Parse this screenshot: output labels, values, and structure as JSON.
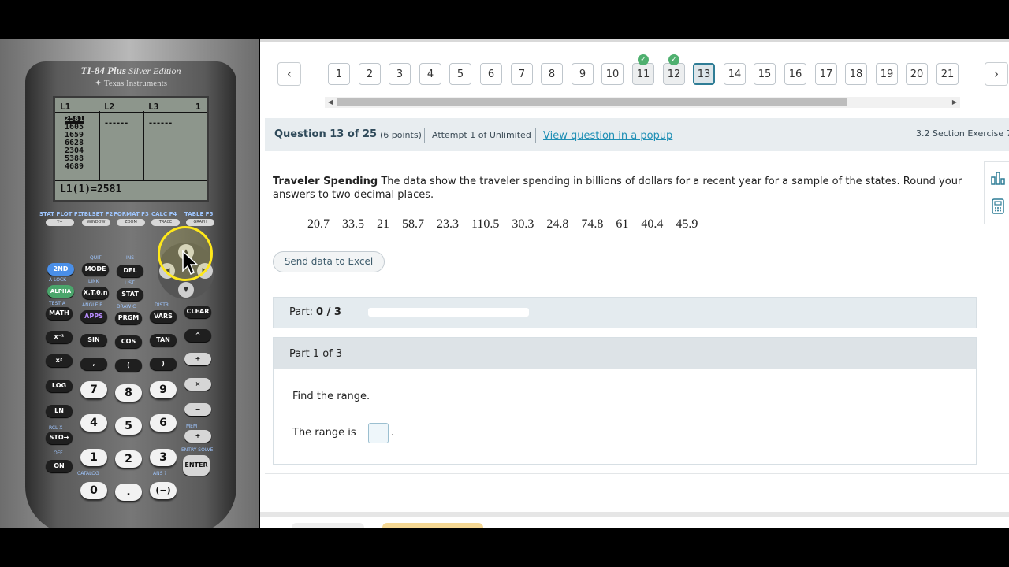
{
  "calculator": {
    "brand": "TI-84 Plus",
    "edition": "Silver Edition",
    "manufacturer": "Texas Instruments",
    "screen": {
      "col_headers": [
        "L1",
        "L2",
        "L3"
      ],
      "col_index": "1",
      "list_values": [
        "2581",
        "1605",
        "1659",
        "6628",
        "2304",
        "5388",
        "4689"
      ],
      "dashes": "------",
      "status_line": "L1(1)=2581"
    },
    "fn_labels": [
      "STAT PLOT F1",
      "TBLSET F2",
      "FORMAT F3",
      "CALC F4",
      "TABLE F5"
    ],
    "fn_keys": [
      "Y=",
      "WINDOW",
      "ZOOM",
      "TRACE",
      "GRAPH"
    ],
    "keys": {
      "second": "2ND",
      "mode": "MODE",
      "del": "DEL",
      "alpha": "ALPHA",
      "xt": "X,T,θ,n",
      "stat": "STAT",
      "math": "MATH",
      "apps": "APPS",
      "prgm": "PRGM",
      "vars": "VARS",
      "clear": "CLEAR",
      "inv": "x⁻¹",
      "sin": "SIN",
      "cos": "COS",
      "tan": "TAN",
      "pow": "^",
      "sq": "x²",
      "comma": ",",
      "lparen": "(",
      "rparen": ")",
      "div": "÷",
      "log": "LOG",
      "mul": "×",
      "ln": "LN",
      "minus": "−",
      "sto": "STO→",
      "plus": "+",
      "on": "ON",
      "enter": "ENTER",
      "neg": "(−)",
      "dot": "."
    },
    "sub_labels": {
      "quit": "QUIT",
      "ins": "INS",
      "alock": "A-LOCK",
      "link": "LINK",
      "list": "LIST",
      "test": "TEST A",
      "angle": "ANGLE B",
      "draw": "DRAW C",
      "distr": "DISTR",
      "entry_solve": "ENTRY SOLVE",
      "catalog": "CATALOG",
      "ans": "ANS ?",
      "mem": "MEM",
      "rcl": "RCL X",
      "off": "OFF"
    },
    "digits": [
      "7",
      "8",
      "9",
      "4",
      "5",
      "6",
      "1",
      "2",
      "3",
      "0"
    ]
  },
  "nav": {
    "prev_icon": "chevron-left-icon",
    "next_icon": "chevron-right-icon",
    "prev_symbol": "‹",
    "next_symbol": "›",
    "questions": [
      "1",
      "2",
      "3",
      "4",
      "5",
      "6",
      "7",
      "8",
      "9",
      "10",
      "11",
      "12",
      "13",
      "14",
      "15",
      "16",
      "17",
      "18",
      "19",
      "20",
      "21"
    ],
    "completed": [
      "11",
      "12"
    ],
    "current": "13",
    "check_symbol": "✓"
  },
  "header": {
    "title": "Question 13 of 25",
    "points": "(6 points)",
    "attempt": "Attempt 1 of Unlimited",
    "popup_link": "View question in a popup",
    "section": "3.2 Section Exercise 7"
  },
  "problem": {
    "title": "Traveler Spending",
    "text": " The data show the traveler spending in billions of dollars for a recent year for a sample of the states. Round your answers to two decimal places.",
    "data": [
      "20.7",
      "33.5",
      "21",
      "58.7",
      "23.3",
      "110.5",
      "30.3",
      "24.8",
      "74.8",
      "61",
      "40.4",
      "45.9"
    ],
    "excel_button": "Send data to Excel"
  },
  "part": {
    "label": "Part:",
    "progress_text": "0 / 3",
    "progress_fraction": 0,
    "box_title": "Part 1 of 3",
    "question": "Find the range.",
    "answer_prefix": "The range is",
    "answer_suffix": "."
  },
  "colors": {
    "accent": "#2f7d96",
    "link": "#1f8fb5",
    "check": "#4fb06f",
    "header_bg": "#e8edf0"
  }
}
